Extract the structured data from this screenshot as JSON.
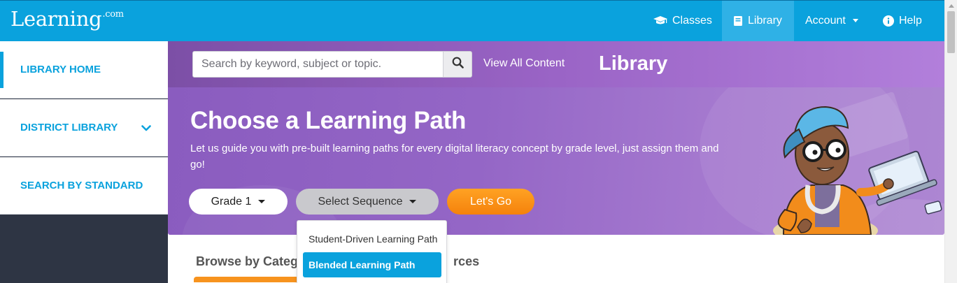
{
  "brand": {
    "name": "Learning",
    "suffix": ".com"
  },
  "nav": {
    "items": [
      {
        "label": "Classes",
        "icon": "graduation-cap-icon"
      },
      {
        "label": "Library",
        "icon": "book-icon",
        "active": true
      },
      {
        "label": "Account",
        "icon": "caret-down-icon"
      },
      {
        "label": "Help",
        "icon": "info-circle-icon"
      }
    ]
  },
  "sidebar": {
    "items": [
      {
        "label": "LIBRARY HOME",
        "active": true
      },
      {
        "label": "DISTRICT LIBRARY",
        "icon": "chevron-down-icon"
      },
      {
        "label": "SEARCH BY STANDARD"
      }
    ]
  },
  "search": {
    "placeholder": "Search by keyword, subject or topic.",
    "value": ""
  },
  "header": {
    "view_all": "View All Content",
    "title": "Library"
  },
  "banner": {
    "title": "Choose a Learning Path",
    "description": "Let us guide you with pre-built learning paths for every digital literacy concept by grade level, just assign them and go!",
    "grade_select": "Grade 1",
    "sequence_select": "Select Sequence",
    "go_button": "Let's Go"
  },
  "sequence_dropdown": {
    "options": [
      "Student-Driven Learning Path",
      "Blended Learning Path"
    ],
    "highlighted": "Blended Learning Path"
  },
  "browse": {
    "left_text": "Browse by Categ",
    "right_text": "rces"
  },
  "colors": {
    "brand_blue": "#0aa2dd",
    "purple": "#9a64c6",
    "orange": "#f7931e",
    "sidebar_dark": "#2e3544"
  }
}
